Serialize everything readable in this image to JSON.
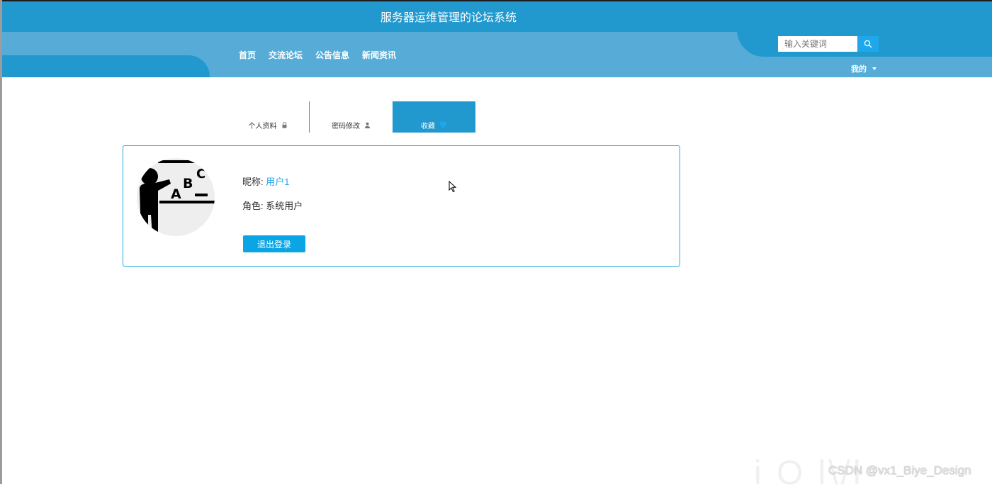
{
  "header": {
    "site_title": "服务器运维管理的论坛系统",
    "nav": [
      "首页",
      "交流论坛",
      "公告信息",
      "新闻资讯"
    ],
    "search_placeholder": "输入关键词",
    "user_menu": "我的"
  },
  "tabs": [
    {
      "label": "个人资料",
      "icon": "lock-icon"
    },
    {
      "label": "密码修改",
      "icon": "user-icon"
    },
    {
      "label": "收藏",
      "icon": "heart-icon",
      "active": true
    }
  ],
  "profile": {
    "nickname_label": "昵称:",
    "nickname": "用户1",
    "role_label": "角色:",
    "role": "系统用户",
    "logout": "退出登录"
  },
  "watermark": "CSDN @vx1_Biye_Design",
  "colors": {
    "header_dark": "#2199cf",
    "header_light": "#56acd7",
    "accent": "#1ea7ea",
    "button": "#09a5e4"
  }
}
